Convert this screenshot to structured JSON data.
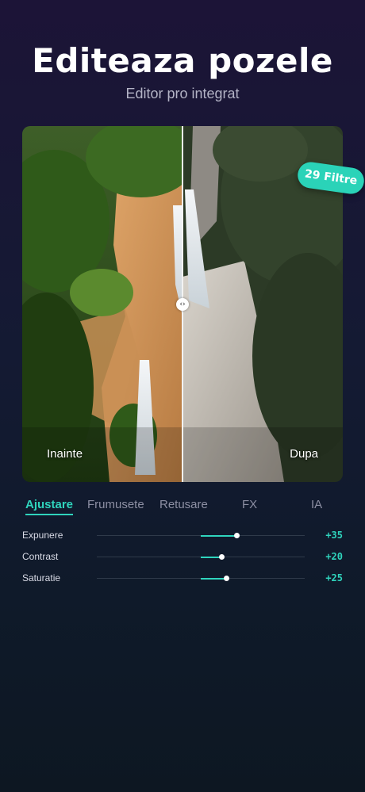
{
  "header": {
    "title": "Editeaza pozele",
    "subtitle": "Editor pro integrat"
  },
  "compare": {
    "before_label": "Inainte",
    "after_label": "Dupa",
    "handle_icon": "left-right-arrows-icon"
  },
  "badge": {
    "label": "29 Filtre",
    "color": "#2ad3b8"
  },
  "tabs": [
    {
      "label": "Ajustare",
      "active": true
    },
    {
      "label": "Frumusete",
      "active": false
    },
    {
      "label": "Retusare",
      "active": false
    },
    {
      "label": "FX",
      "active": false
    },
    {
      "label": "IA",
      "active": false
    }
  ],
  "adjustments": [
    {
      "name": "Expunere",
      "value": "+35",
      "amount": 35
    },
    {
      "name": "Contrast",
      "value": "+20",
      "amount": 20
    },
    {
      "name": "Saturatie",
      "value": "+25",
      "amount": 25
    }
  ],
  "colors": {
    "accent": "#2fd4bd",
    "background_top": "#1c1437",
    "background_bottom": "#0d1722"
  }
}
